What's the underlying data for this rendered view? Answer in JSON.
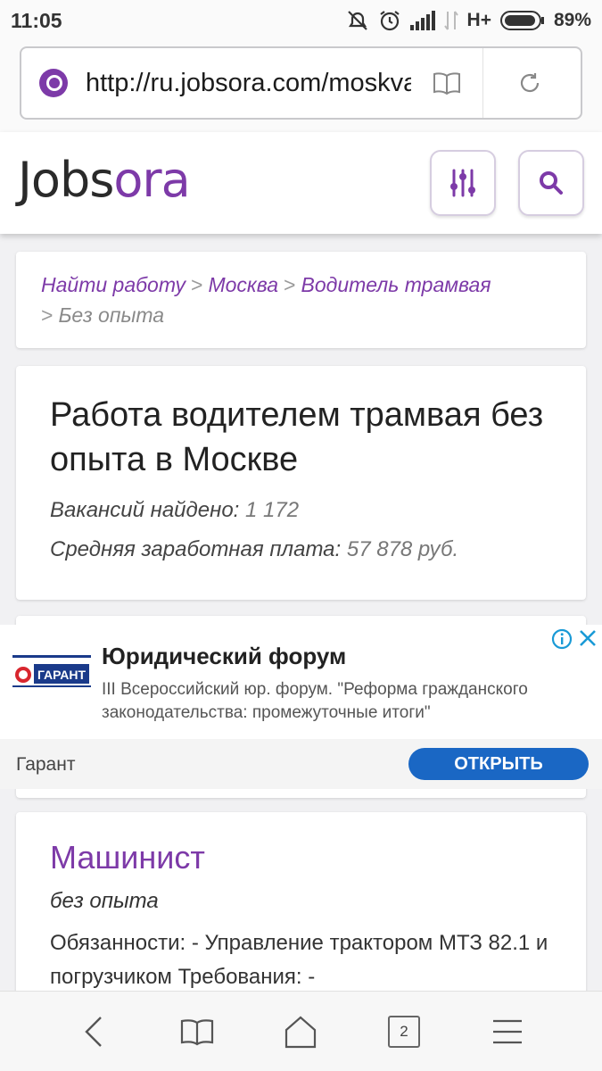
{
  "status": {
    "time": "11:05",
    "network": "H+",
    "battery": "89%"
  },
  "browser": {
    "url": "http://ru.jobsora.com/moskva",
    "open_tabs": "2",
    "icons": [
      "back-icon",
      "bookmarks-icon",
      "home-icon",
      "tabs-icon",
      "menu-icon"
    ]
  },
  "site": {
    "logo_dark": "Jobs",
    "logo_accent": "ora",
    "accent_color": "#7d3aa8"
  },
  "breadcrumb": {
    "items": [
      "Найти работу",
      "Москва",
      "Водитель трамвая"
    ],
    "current": "Без опыта"
  },
  "summary": {
    "title": "Работа водителем трамвая без опыта в Москве",
    "vacancies_label": "Вакансий найдено:",
    "vacancies_value": "1 172",
    "salary_label": "Средняя заработная плата:",
    "salary_value": "57 878 руб."
  },
  "ad": {
    "title": "Юридический форум",
    "text": "III Всероссийский юр. форум. \"Реформа гражданского законодательства: промежуточные итоги\"",
    "advertiser": "Гарант",
    "cta": "ОТКРЫТЬ",
    "cta_color": "#1a67c4",
    "logo_text": "ГАРАНТ"
  },
  "job": {
    "title": "Машинист",
    "experience": "без опыта",
    "description": "Обязанности: - Управление трактором МТЗ 82.1 и погрузчиком Требования: -"
  }
}
